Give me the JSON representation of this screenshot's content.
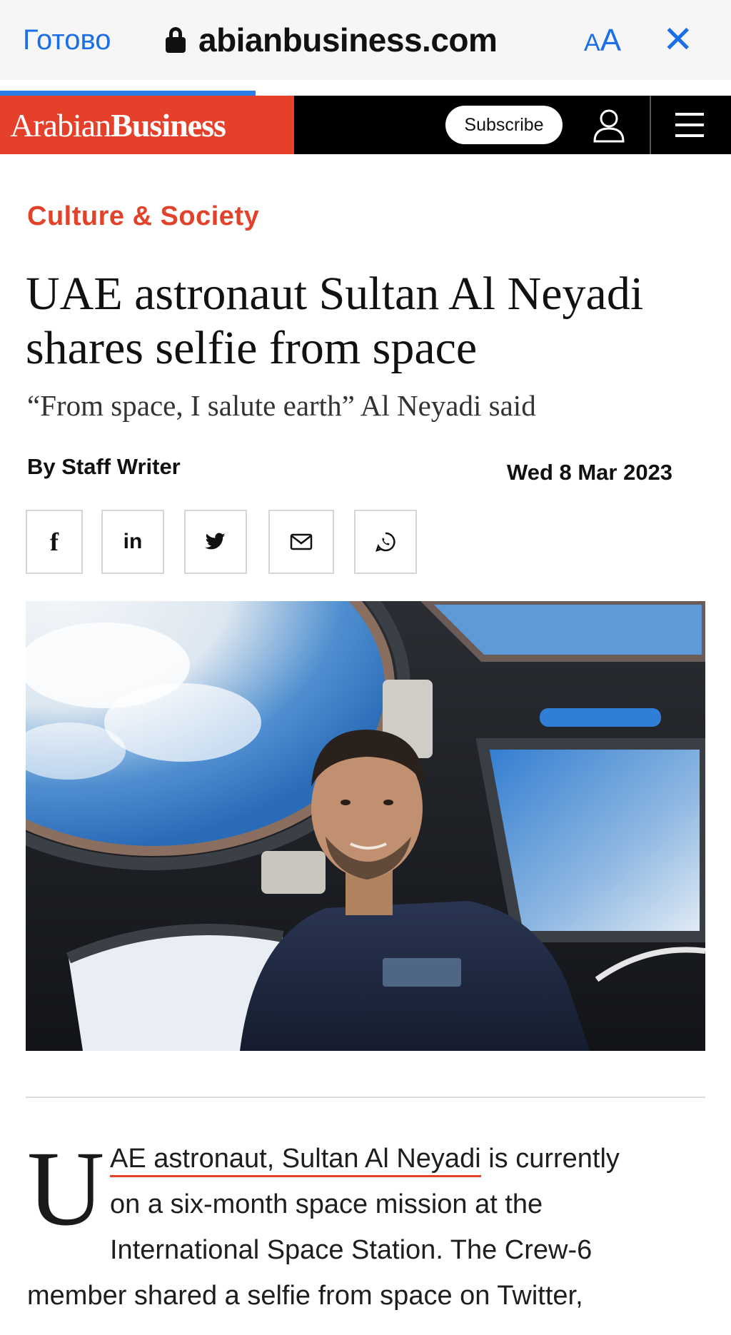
{
  "browser": {
    "done_label": "Готово",
    "url": "abianbusiness.com",
    "text_size_label_small": "A",
    "text_size_label_large": "A",
    "close_label": "✕",
    "progress": 0.35
  },
  "site": {
    "logo_part1": "Arabian",
    "logo_part2": "Business",
    "subscribe_label": "Subscribe",
    "icons": [
      "user-icon",
      "menu-icon"
    ]
  },
  "article": {
    "category": "Culture & Society",
    "headline": "UAE astronaut Sultan Al Neyadi shares selfie from space",
    "subhead": "“From space, I salute earth” Al Neyadi said",
    "byline": "By Staff Writer",
    "date": "Wed 8 Mar 2023",
    "share_buttons": [
      {
        "icon": "facebook-icon",
        "glyph": "f"
      },
      {
        "icon": "linkedin-icon",
        "glyph": "in"
      },
      {
        "icon": "twitter-icon",
        "glyph": ""
      },
      {
        "icon": "email-icon",
        "glyph": ""
      },
      {
        "icon": "whatsapp-icon",
        "glyph": ""
      }
    ],
    "dropcap": "U",
    "link_text": "AE astronaut, Sultan Al Neyadi",
    "line1_rest": " is currently",
    "line2": "on a six-month space mission at the",
    "line3": "International Space Station. The Crew-6",
    "line4": "member shared a selfie from space on Twitter,"
  },
  "colors": {
    "accent": "#e2412a",
    "safari_blue": "#1a6fe6",
    "header_bg": "#000000"
  }
}
